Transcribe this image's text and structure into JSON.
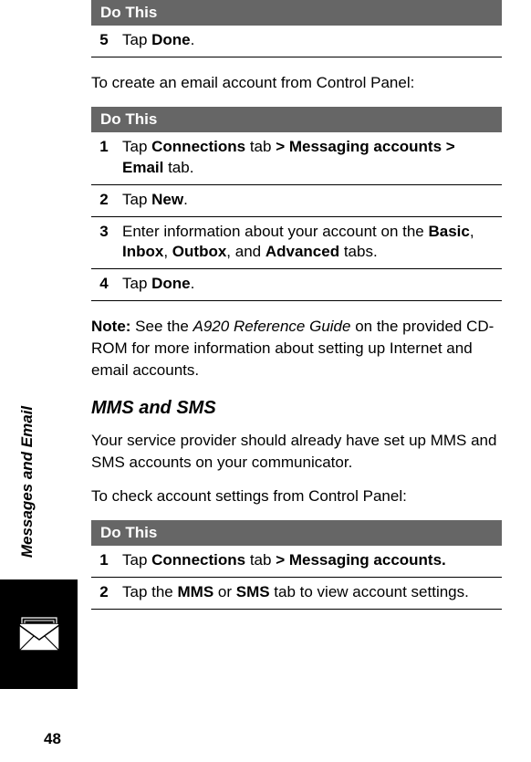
{
  "sideTab": "Messages and Email",
  "pageNumber": "48",
  "table1": {
    "header": "Do This",
    "rows": [
      {
        "num": "5",
        "pre": "Tap ",
        "b1": "Done",
        "post": "."
      }
    ]
  },
  "para1": "To create an email account from Control Panel:",
  "table2": {
    "header": "Do This",
    "rows": [
      {
        "num": "1",
        "t1": "Tap ",
        "b1": "Connections",
        "t2": " tab ",
        "b2": "> Messaging accounts > Email",
        "t3": " tab."
      },
      {
        "num": "2",
        "t1": "Tap ",
        "b1": "New",
        "t2": "."
      },
      {
        "num": "3",
        "t1": "Enter information about your account on the ",
        "b1": "Basic",
        "t2": ", ",
        "b2": "Inbox",
        "t3": ", ",
        "b3": "Outbox",
        "t4": ", and ",
        "b4": "Advanced",
        "t5": " tabs."
      },
      {
        "num": "4",
        "t1": "Tap ",
        "b1": "Done",
        "t2": "."
      }
    ]
  },
  "note": {
    "label": "Note:",
    "t1": " See the ",
    "i1": "A920 Reference Guide",
    "t2": " on the provided CD-ROM for more information about setting up Internet and email accounts."
  },
  "heading2": "MMS and SMS",
  "para2": "Your service provider should already have set up MMS and SMS accounts on your communicator.",
  "para3": "To check account settings from Control Panel:",
  "table3": {
    "header": "Do This",
    "rows": [
      {
        "num": "1",
        "t1": "Tap ",
        "b1": "Connections",
        "t2": " tab ",
        "b2": "> Messaging accounts."
      },
      {
        "num": "2",
        "t1": "Tap the ",
        "b1": "MMS",
        "t2": " or ",
        "b2": "SMS",
        "t3": " tab to view account settings."
      }
    ]
  }
}
